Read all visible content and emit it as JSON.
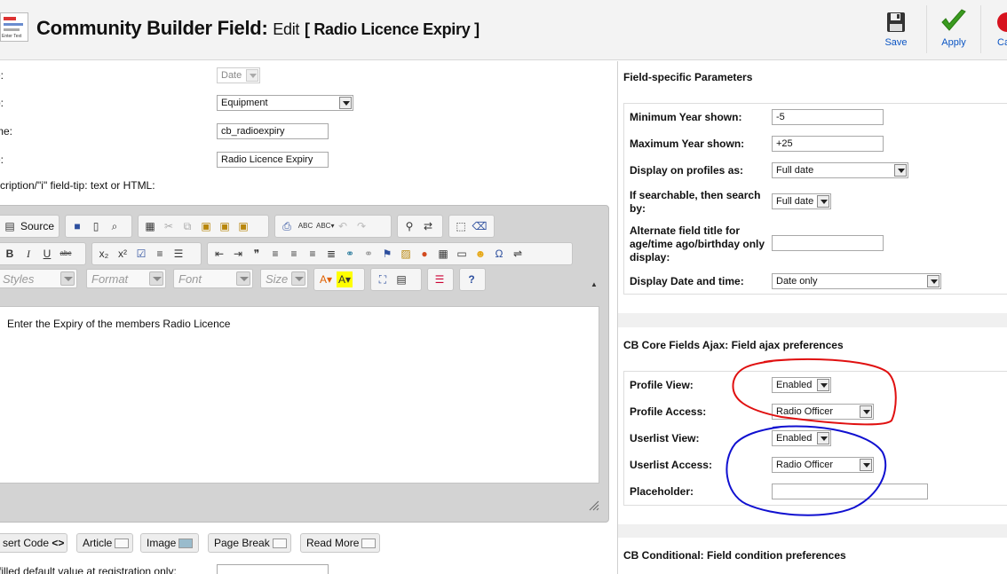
{
  "header": {
    "logo_text": "Enter Text",
    "title_main": "Community Builder Field:",
    "title_mode": "Edit",
    "title_name": "[ Radio Licence Expiry ]"
  },
  "toolbar": {
    "save": "Save",
    "apply": "Apply",
    "cancel": "Ca"
  },
  "form": {
    "type_label": "e:",
    "type_value": "Date",
    "tab_label": "b:",
    "tab_value": "Equipment",
    "name_label": "me:",
    "name_value": "cb_radioexpiry",
    "title_label": "e:",
    "title_value": "Radio Licence Expiry",
    "desc_label": "scription/\"i\" field-tip: text or HTML:"
  },
  "editor": {
    "source_label": "Source",
    "styles": "Styles",
    "format": "Format",
    "font": "Font",
    "size": "Size",
    "content": "Enter the Expiry of the members Radio Licence"
  },
  "editor_buttons": {
    "insert_code": "sert Code",
    "article": "Article",
    "image": "Image",
    "page_break": "Page Break",
    "read_more": "Read More"
  },
  "default_label": "-filled default value at registration only:",
  "params": {
    "section_title": "Field-specific Parameters",
    "min_year_label": "Minimum Year shown:",
    "min_year_value": "-5",
    "max_year_label": "Maximum Year shown:",
    "max_year_value": "+25",
    "display_profiles_label": "Display on profiles as:",
    "display_profiles_value": "Full date",
    "searchable_label": "If searchable, then search by:",
    "searchable_value": "Full date",
    "alt_title_label": "Alternate field title for age/time ago/birthday only display:",
    "alt_title_value": "",
    "date_time_label": "Display Date and time:",
    "date_time_value": "Date only"
  },
  "ajax": {
    "section_title": "CB Core Fields Ajax: Field ajax preferences",
    "profile_view_label": "Profile View:",
    "profile_view_value": "Enabled",
    "profile_access_label": "Profile Access:",
    "profile_access_value": "Radio Officer",
    "userlist_view_label": "Userlist View:",
    "userlist_view_value": "Enabled",
    "userlist_access_label": "Userlist Access:",
    "userlist_access_value": "Radio Officer",
    "placeholder_label": "Placeholder:",
    "placeholder_value": ""
  },
  "conditional": {
    "section_title": "CB Conditional: Field condition preferences"
  },
  "colors": {
    "annotation_red": "#e01010",
    "annotation_blue": "#1010d0",
    "toolbar_link": "#0b55c4",
    "apply_green": "#3a9b1f"
  }
}
